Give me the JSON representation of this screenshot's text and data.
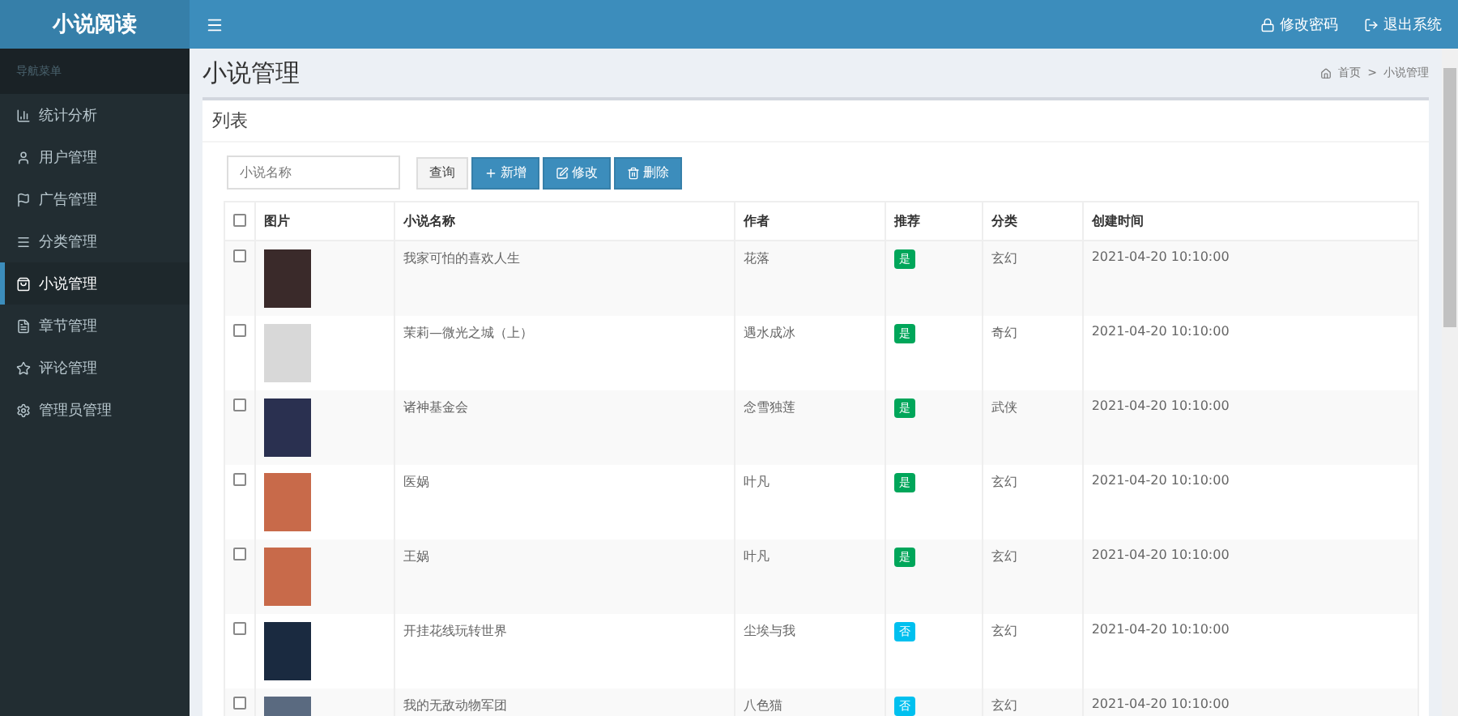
{
  "brand": "小说阅读",
  "header": {
    "links": [
      "修改密码",
      "退出系统"
    ]
  },
  "sidebar": {
    "heading": "导航菜单",
    "items": [
      {
        "label": "统计分析",
        "selected": false
      },
      {
        "label": "用户管理",
        "selected": false
      },
      {
        "label": "广告管理",
        "selected": false
      },
      {
        "label": "分类管理",
        "selected": false
      },
      {
        "label": "小说管理",
        "selected": true
      },
      {
        "label": "章节管理",
        "selected": false
      },
      {
        "label": "评论管理",
        "selected": false
      },
      {
        "label": "管理员管理",
        "selected": false
      }
    ]
  },
  "page_title": "小说管理",
  "breadcrumb": [
    "首页",
    ">",
    "小说管理"
  ],
  "panel_title": "列表",
  "search": {
    "placeholder": "小说名称"
  },
  "buttons": [
    {
      "kind": "plain",
      "label": "查询"
    },
    {
      "kind": "add",
      "label": "新增"
    },
    {
      "kind": "edit",
      "label": "修改"
    },
    {
      "kind": "delete",
      "label": "删除"
    }
  ],
  "table": {
    "select_all_checked": false,
    "columns": [
      "图片",
      "小说名称",
      "作者",
      "推荐",
      "分类",
      "创建时间"
    ],
    "rows": [
      {
        "checked": false,
        "title": "我家可怕的喜欢人生",
        "author": "花落",
        "recommended": true,
        "recommend_label": "是",
        "category": "玄幻",
        "created": "2021-04-20 10:10:00"
      },
      {
        "checked": false,
        "title": "茉莉—微光之城（上）",
        "author": "遇水成冰",
        "recommended": true,
        "recommend_label": "是",
        "category": "奇幻",
        "created": "2021-04-20 10:10:00"
      },
      {
        "checked": false,
        "title": "诸神基金会",
        "author": "念雪独莲",
        "recommended": true,
        "recommend_label": "是",
        "category": "武侠",
        "created": "2021-04-20 10:10:00"
      },
      {
        "checked": false,
        "title": "医娲",
        "author": "叶凡",
        "recommended": true,
        "recommend_label": "是",
        "category": "玄幻",
        "created": "2021-04-20 10:10:00"
      },
      {
        "checked": false,
        "title": "王娲",
        "author": "叶凡",
        "recommended": true,
        "recommend_label": "是",
        "category": "玄幻",
        "created": "2021-04-20 10:10:00"
      },
      {
        "checked": false,
        "title": "开挂花线玩转世界",
        "author": "尘埃与我",
        "recommended": false,
        "recommend_label": "否",
        "category": "玄幻",
        "created": "2021-04-20 10:10:00"
      },
      {
        "checked": false,
        "title": "我的无敌动物军团",
        "author": "八色猫",
        "recommended": false,
        "recommend_label": "否",
        "category": "玄幻",
        "created": "2021-04-20 10:10:00"
      }
    ]
  }
}
